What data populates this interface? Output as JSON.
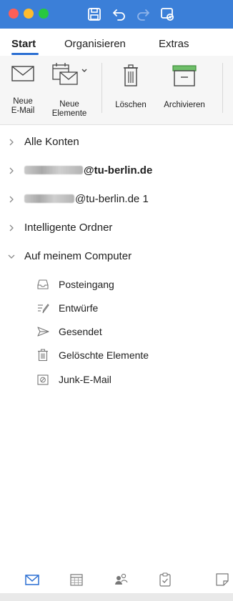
{
  "titlebar": {
    "icons": [
      "save-icon",
      "undo-icon",
      "redo-icon",
      "sync-icon"
    ]
  },
  "ribbon": {
    "tabs": [
      {
        "label": "Start",
        "active": true
      },
      {
        "label": "Organisieren",
        "active": false
      },
      {
        "label": "Extras",
        "active": false
      }
    ]
  },
  "toolbar": {
    "new_email": {
      "line1": "Neue",
      "line2": "E-Mail"
    },
    "new_items": {
      "line1": "Neue",
      "line2": "Elemente"
    },
    "delete": {
      "label": "Löschen"
    },
    "archive": {
      "label": "Archivieren"
    }
  },
  "folders": {
    "all_accounts": "Alle Konten",
    "account1_domain": "@tu-berlin.de",
    "account2_domain": "@tu-berlin.de 1",
    "smart_folders": "Intelligente Ordner",
    "on_my_computer": "Auf meinem Computer",
    "sub": [
      {
        "label": "Posteingang",
        "icon": "inbox-icon"
      },
      {
        "label": "Entwürfe",
        "icon": "drafts-icon"
      },
      {
        "label": "Gesendet",
        "icon": "sent-icon"
      },
      {
        "label": "Gelöschte Elemente",
        "icon": "trash-icon"
      },
      {
        "label": "Junk-E-Mail",
        "icon": "junk-icon"
      }
    ]
  },
  "bottom_nav": {
    "icons": [
      "mail-icon",
      "calendar-icon",
      "people-icon",
      "tasks-icon",
      "notes-icon"
    ]
  },
  "colors": {
    "titlebar": "#3b7fd8",
    "accent": "#2a6ed2"
  }
}
